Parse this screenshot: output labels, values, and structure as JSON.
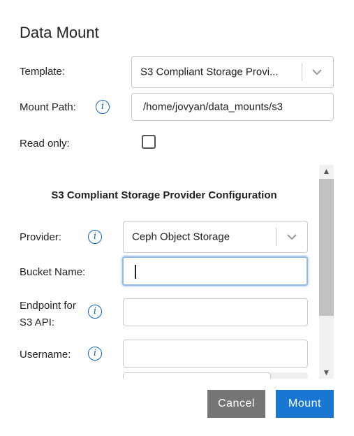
{
  "dialog": {
    "title": "Data Mount"
  },
  "template": {
    "label": "Template:",
    "value": "S3 Compliant Storage Provi..."
  },
  "mount_path": {
    "label": "Mount Path:",
    "value": "/home/jovyan/data_mounts/s3"
  },
  "read_only": {
    "label": "Read only:",
    "checked": false
  },
  "config": {
    "section_title": "S3 Compliant Storage Provider Configuration",
    "provider": {
      "label": "Provider:",
      "value": "Ceph Object Storage"
    },
    "bucket": {
      "label": "Bucket Name:",
      "value": ""
    },
    "endpoint": {
      "label_line1": "Endpoint for",
      "label_line2": "S3 API:",
      "value": ""
    },
    "username": {
      "label": "Username:",
      "value": ""
    }
  },
  "buttons": {
    "cancel": "Cancel",
    "mount": "Mount"
  },
  "colors": {
    "accent": "#1976d2",
    "cancel_bg": "#757575",
    "focus_border": "#90b8e8"
  },
  "icons": {
    "info": "info-icon",
    "chevron": "chevron-down-icon"
  }
}
